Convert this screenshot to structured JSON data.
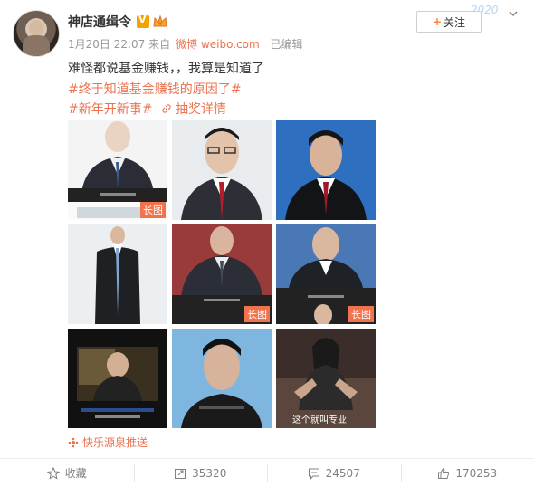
{
  "post": {
    "username": "神店通缉令",
    "date": "1月20日 22:07",
    "from_label": "来自",
    "source": "微博 weibo.com",
    "edited": "已编辑",
    "text": "难怪都说基金赚钱，，我算是知道了",
    "tag1": "#终于知道基金赚钱的原因了#",
    "tag2": "#新年开新事#",
    "lottery": "抽奖详情",
    "follow_label": "关注",
    "year_deco": "2020",
    "source_footer": "快乐源泉推送",
    "images": [
      {
        "badge": "长图"
      },
      {
        "badge": ""
      },
      {
        "badge": ""
      },
      {
        "badge": ""
      },
      {
        "badge": "长图"
      },
      {
        "badge": "长图"
      },
      {
        "badge": ""
      },
      {
        "badge": ""
      },
      {
        "badge": "",
        "caption": "这个就叫专业"
      }
    ]
  },
  "actions": {
    "favorite": "收藏",
    "repost": "35320",
    "comment": "24507",
    "like": "170253"
  },
  "icons": [
    "shield-icon",
    "crown-icon",
    "chevron-down-icon",
    "link-icon",
    "star-icon",
    "repost-icon",
    "comment-icon",
    "like-icon",
    "dot-icon"
  ],
  "colors": {
    "accent": "#eb7350",
    "meta": "#999999",
    "badge": "#f0734e"
  }
}
